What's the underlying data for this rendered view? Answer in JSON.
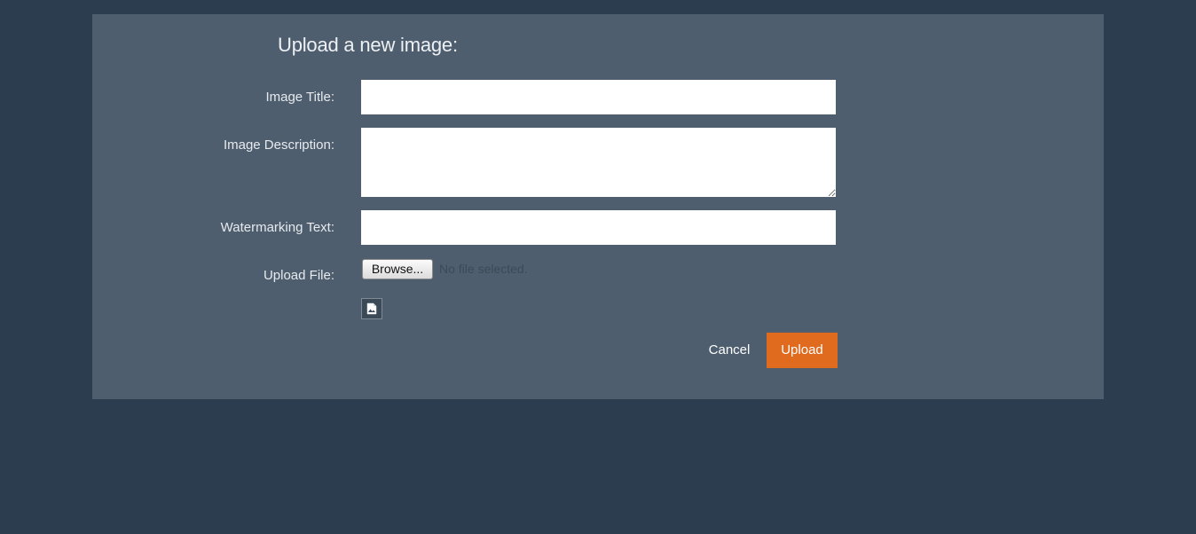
{
  "form": {
    "heading": "Upload a new image:",
    "fields": {
      "title": {
        "label": "Image Title:",
        "value": "",
        "placeholder": ""
      },
      "description": {
        "label": "Image Description:",
        "value": "",
        "placeholder": ""
      },
      "watermark": {
        "label": "Watermarking Text:",
        "value": "",
        "placeholder": ""
      },
      "file": {
        "label": "Upload File:",
        "browse_label": "Browse...",
        "status": "No file selected."
      }
    },
    "preview_icon": "image-icon",
    "actions": {
      "cancel_label": "Cancel",
      "upload_label": "Upload"
    }
  },
  "colors": {
    "page_background": "#2c3d50",
    "panel_background": "#4e5e6e",
    "accent": "#e06a1e"
  }
}
